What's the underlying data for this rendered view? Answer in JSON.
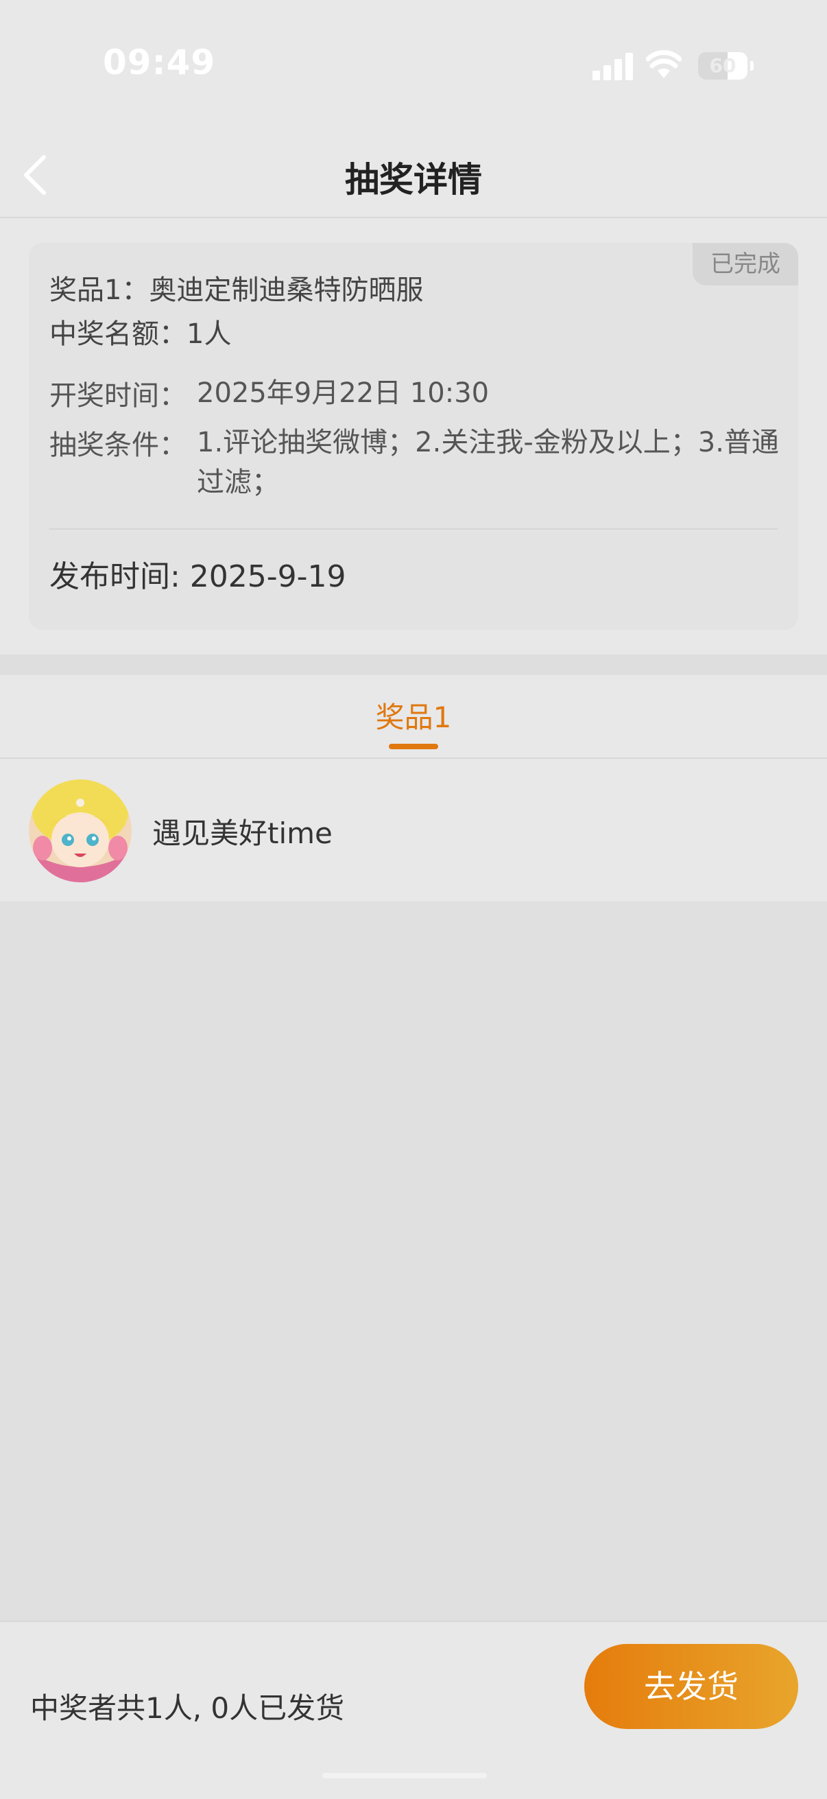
{
  "status_bar": {
    "time": "09:49",
    "battery": "60",
    "battery_level_percent": 60
  },
  "nav": {
    "title": "抽奖详情",
    "back_icon": "chevron-left-icon"
  },
  "lottery": {
    "status": "已完成",
    "prize_line": "奖品1：奥迪定制迪桑特防晒服",
    "quota_line": "中奖名额：1人",
    "draw_time_label": "开奖时间：",
    "draw_time_value": "2025年9月22日 10:30",
    "conditions_label": "抽奖条件：",
    "conditions_value": "1.评论抽奖微博；2.关注我-金粉及以上；3.普通过滤；",
    "publish_line": "发布时间: 2025-9-19"
  },
  "tabs": [
    {
      "label": "奖品1",
      "active": true
    }
  ],
  "winners": [
    {
      "name": "遇见美好time",
      "avatar_icon": "anime-girl-avatar"
    }
  ],
  "footer": {
    "summary": "中奖者共1人, 0人已发货",
    "ship_label": "去发货"
  },
  "colors": {
    "accent": "#e0780f",
    "button_gradient_start": "#e57c0c",
    "button_gradient_end": "#e8a52c",
    "background": "#e8e8e8"
  }
}
